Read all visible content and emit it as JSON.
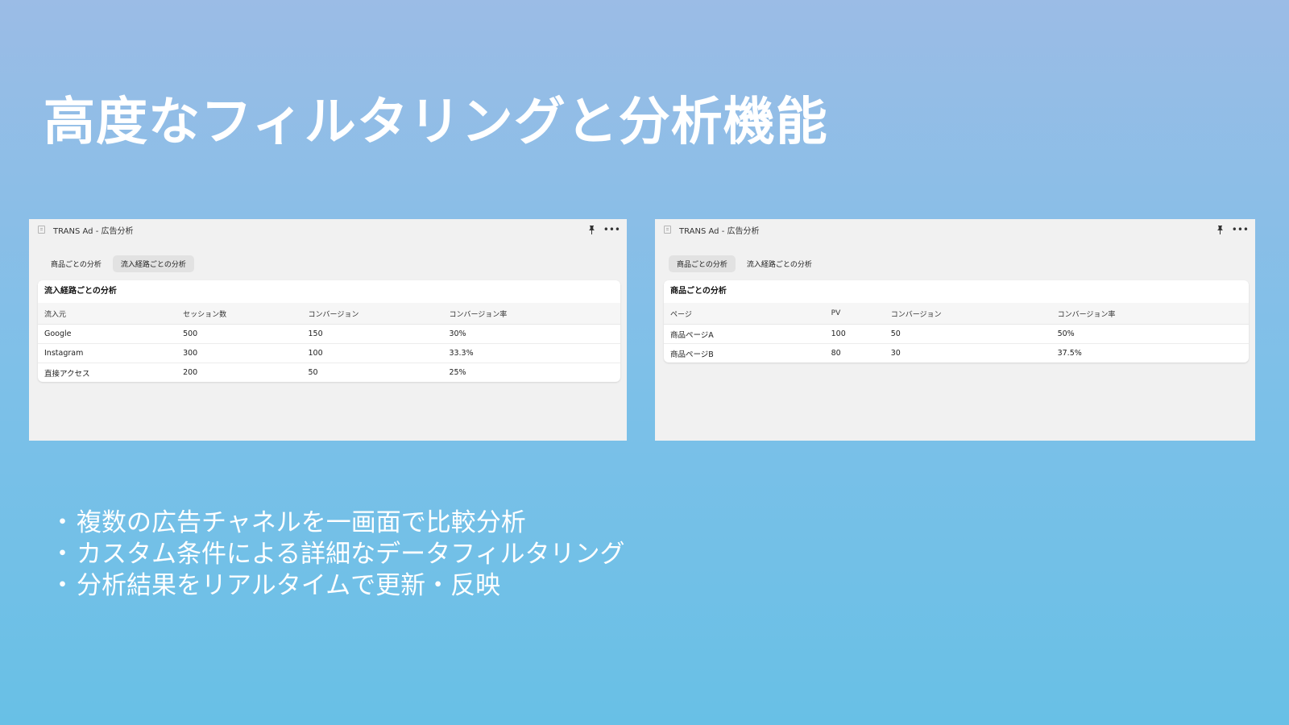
{
  "slide": {
    "title": "高度なフィルタリングと分析機能",
    "bullets": [
      "複数の広告チャネルを一画面で比較分析",
      "カスタム条件による詳細なデータフィルタリング",
      "分析結果をリアルタイムで更新・反映"
    ]
  },
  "window_left": {
    "title": "TRANS Ad - 広告分析",
    "tabs": [
      {
        "label": "商品ごとの分析",
        "active": false
      },
      {
        "label": "流入経路ごとの分析",
        "active": true
      }
    ],
    "card_title": "流入経路ごとの分析",
    "columns": [
      "流入元",
      "セッション数",
      "コンバージョン",
      "コンバージョン率"
    ],
    "rows": [
      [
        "Google",
        "500",
        "150",
        "30%"
      ],
      [
        "Instagram",
        "300",
        "100",
        "33.3%"
      ],
      [
        "直接アクセス",
        "200",
        "50",
        "25%"
      ]
    ]
  },
  "window_right": {
    "title": "TRANS Ad - 広告分析",
    "tabs": [
      {
        "label": "商品ごとの分析",
        "active": true
      },
      {
        "label": "流入経路ごとの分析",
        "active": false
      }
    ],
    "card_title": "商品ごとの分析",
    "columns": [
      "ページ",
      "PV",
      "コンバージョン",
      "コンバージョン率"
    ],
    "rows": [
      [
        "商品ページA",
        "100",
        "50",
        "50%"
      ],
      [
        "商品ページB",
        "80",
        "30",
        "37.5%"
      ]
    ]
  },
  "icons": {
    "app": "app-icon",
    "pin": "pin-icon",
    "more": "more-icon"
  }
}
